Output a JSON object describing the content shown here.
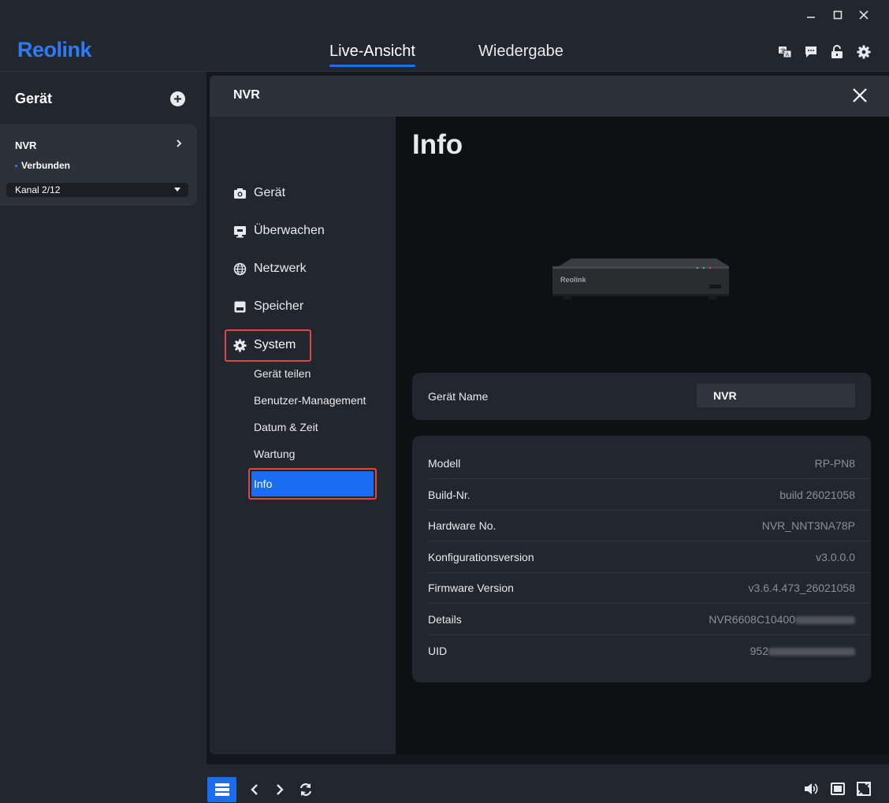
{
  "app": {
    "logo": "Reolink"
  },
  "window_controls": {
    "minimize": "minimize-icon",
    "maximize": "maximize-icon",
    "close": "close-icon"
  },
  "header": {
    "tabs": [
      {
        "label": "Live-Ansicht",
        "active": true
      },
      {
        "label": "Wiedergabe",
        "active": false
      }
    ],
    "icons": [
      "translate-icon",
      "message-icon",
      "unlock-icon",
      "gear-icon"
    ]
  },
  "sidebar": {
    "title": "Gerät",
    "device": {
      "name": "NVR",
      "status": "Verbunden",
      "channel": "Kanal 2/12"
    }
  },
  "dialog": {
    "title": "NVR",
    "nav": {
      "items": [
        {
          "label": "Gerät",
          "icon": "camera-icon"
        },
        {
          "label": "Überwachen",
          "icon": "monitor-icon"
        },
        {
          "label": "Netzwerk",
          "icon": "globe-icon"
        },
        {
          "label": "Speicher",
          "icon": "storage-icon"
        },
        {
          "label": "System",
          "icon": "gear-icon"
        }
      ],
      "system_sub": [
        "Gerät teilen",
        "Benutzer-Management",
        "Datum & Zeit",
        "Wartung",
        "Info"
      ]
    },
    "content": {
      "title": "Info",
      "device_name_label": "Gerät Name",
      "device_name_value": "NVR",
      "rows": [
        {
          "key": "Modell",
          "value": "RP-PN8"
        },
        {
          "key": "Build-Nr.",
          "value": "build 26021058"
        },
        {
          "key": "Hardware No.",
          "value": "NVR_NNT3NA78P"
        },
        {
          "key": "Konfigurationsversion",
          "value": "v3.0.0.0"
        },
        {
          "key": "Firmware Version",
          "value": "v3.6.4.473_26021058"
        },
        {
          "key": "Details",
          "value": "NVR6608C10400"
        },
        {
          "key": "UID",
          "value": "952"
        }
      ]
    }
  },
  "accent_color": "#1a6cf0",
  "highlight_color": "#e0463f"
}
